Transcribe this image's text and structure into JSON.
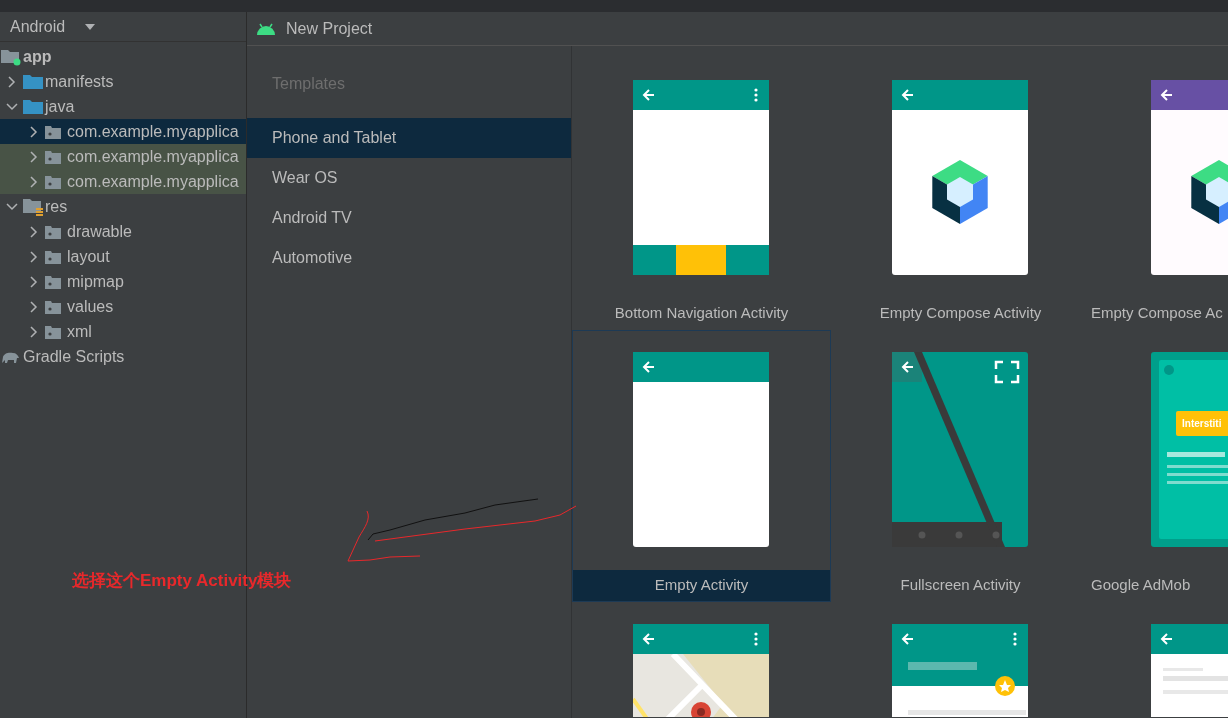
{
  "project_panel": {
    "view": "Android",
    "tree": [
      {
        "label": "app",
        "kind": "module",
        "children": [
          {
            "label": "manifests",
            "kind": "folder",
            "expanded": false
          },
          {
            "label": "java",
            "kind": "folder",
            "expanded": true,
            "children": [
              {
                "label": "com.example.myapplica",
                "kind": "package",
                "expanded": false,
                "selected": true,
                "test_source": false
              },
              {
                "label": "com.example.myapplica",
                "kind": "package",
                "expanded": false,
                "selected": false,
                "test_source": true
              },
              {
                "label": "com.example.myapplica",
                "kind": "package",
                "expanded": false,
                "selected": false,
                "test_source": true
              }
            ]
          },
          {
            "label": "res",
            "kind": "resources",
            "expanded": true,
            "children": [
              {
                "label": "drawable",
                "kind": "package",
                "expanded": false
              },
              {
                "label": "layout",
                "kind": "package",
                "expanded": false
              },
              {
                "label": "mipmap",
                "kind": "package",
                "expanded": false
              },
              {
                "label": "values",
                "kind": "package",
                "expanded": false
              },
              {
                "label": "xml",
                "kind": "package",
                "expanded": false
              }
            ]
          }
        ]
      },
      {
        "label": "Gradle Scripts",
        "kind": "gradle"
      }
    ]
  },
  "dialog": {
    "title": "New Project",
    "categories_heading": "Templates",
    "categories": [
      {
        "label": "Phone and Tablet",
        "selected": true
      },
      {
        "label": "Wear OS",
        "selected": false
      },
      {
        "label": "Android TV",
        "selected": false
      },
      {
        "label": "Automotive",
        "selected": false
      }
    ],
    "templates": [
      {
        "label": "Bottom Navigation Activity",
        "kind": "bottom_nav",
        "selected": false
      },
      {
        "label": "Empty Compose Activity",
        "kind": "compose",
        "selected": false
      },
      {
        "label": "Empty Compose Ac",
        "kind": "compose_m3",
        "selected": false
      },
      {
        "label": "Empty Activity",
        "kind": "empty",
        "selected": true
      },
      {
        "label": "Fullscreen Activity",
        "kind": "fullscreen",
        "selected": false
      },
      {
        "label": "Google AdMob",
        "kind": "admob",
        "badge_text": "Interstiti",
        "selected": false
      },
      {
        "kind": "maps",
        "selected": false
      },
      {
        "kind": "scrolling",
        "selected": false
      },
      {
        "kind": "list",
        "selected": false
      }
    ]
  },
  "annotation": {
    "text": "选择这个Empty Activity模块"
  }
}
